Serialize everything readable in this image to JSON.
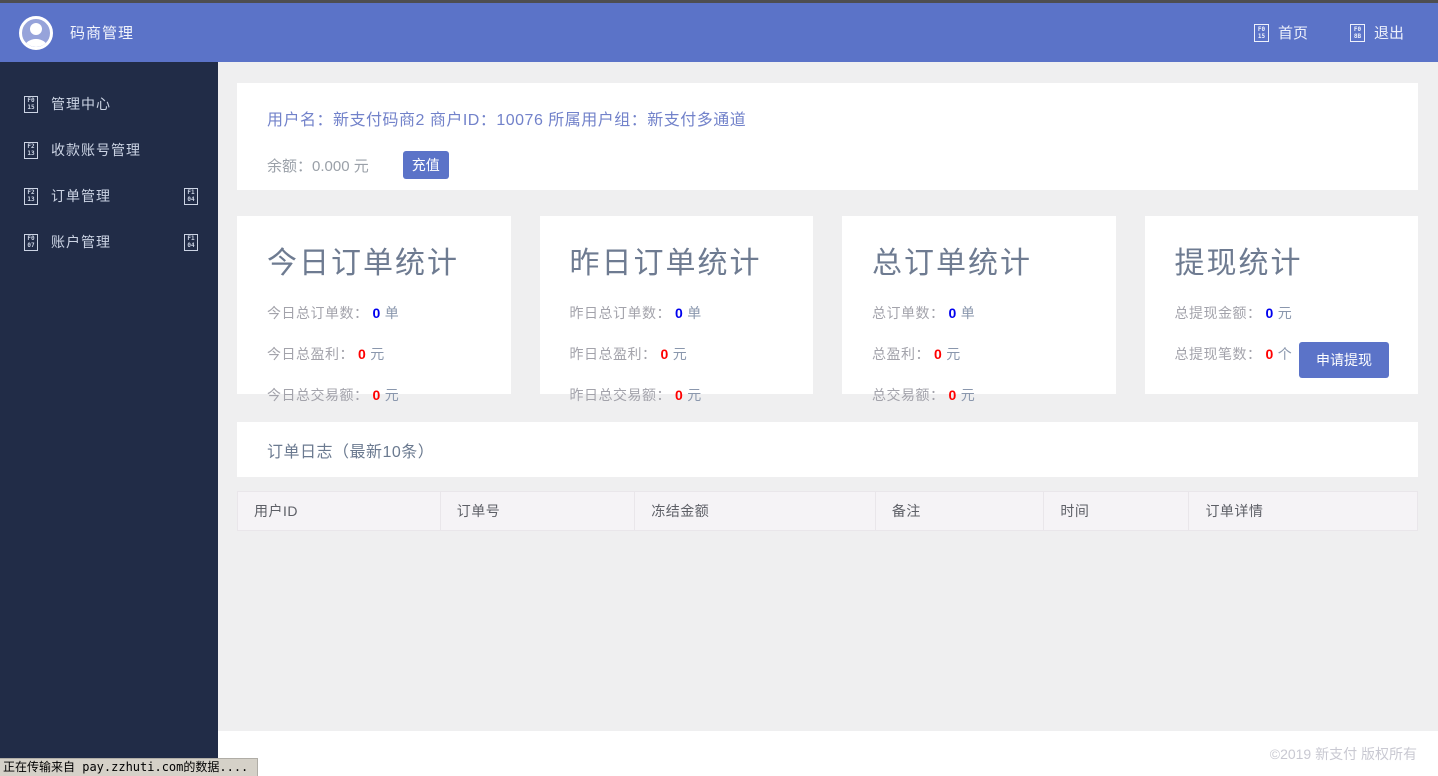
{
  "colors": {
    "header_bg": "#5b73c8",
    "sidebar_bg": "#212c47",
    "main_bg": "#efeff0",
    "accent_blue": "#5b73c8",
    "value_blue": "#0000ee",
    "value_red": "#ff0000"
  },
  "header": {
    "brand": "码商管理",
    "nav": [
      {
        "name": "home",
        "label": "首页",
        "icon": "home-icon",
        "glyph_hex": "F015"
      },
      {
        "name": "logout",
        "label": "退出",
        "icon": "logout-icon",
        "glyph_hex": "F08B"
      }
    ]
  },
  "sidebar": {
    "items": [
      {
        "name": "admin-center",
        "label": "管理中心",
        "icon": "home-icon",
        "glyph_hex": "F015",
        "chevron_hex": ""
      },
      {
        "name": "payment-accounts",
        "label": "收款账号管理",
        "icon": "card-icon",
        "glyph_hex": "F213",
        "chevron_hex": ""
      },
      {
        "name": "order-management",
        "label": "订单管理",
        "icon": "list-icon",
        "glyph_hex": "F213",
        "chevron_hex": "F104"
      },
      {
        "name": "account-management",
        "label": "账户管理",
        "icon": "user-icon",
        "glyph_hex": "F007",
        "chevron_hex": "F104"
      }
    ]
  },
  "user_card": {
    "info_line": "用户名：新支付码商2 商户ID：10076 所属用户组：新支付多通道",
    "balance": "余额：0.000 元",
    "recharge_button": "充值"
  },
  "stat_cards": [
    {
      "title": "今日订单统计",
      "rows": [
        {
          "label": "今日总订单数：",
          "value": "0",
          "unit": "单",
          "color": "blue"
        },
        {
          "label": "今日总盈利：",
          "value": "0",
          "unit": "元",
          "color": "red"
        },
        {
          "label": "今日总交易额：",
          "value": "0",
          "unit": "元",
          "color": "red"
        }
      ]
    },
    {
      "title": "昨日订单统计",
      "rows": [
        {
          "label": "昨日总订单数：",
          "value": "0",
          "unit": "单",
          "color": "blue"
        },
        {
          "label": "昨日总盈利：",
          "value": "0",
          "unit": "元",
          "color": "red"
        },
        {
          "label": "昨日总交易额：",
          "value": "0",
          "unit": "元",
          "color": "red"
        }
      ]
    },
    {
      "title": "总订单统计",
      "rows": [
        {
          "label": "总订单数：",
          "value": "0",
          "unit": "单",
          "color": "blue"
        },
        {
          "label": "总盈利：",
          "value": "0",
          "unit": "元",
          "color": "red"
        },
        {
          "label": "总交易额：",
          "value": "0",
          "unit": "元",
          "color": "red"
        }
      ]
    },
    {
      "title": "提现统计",
      "rows": [
        {
          "label": "总提现金额：",
          "value": "0",
          "unit": "元",
          "color": "blue"
        },
        {
          "label": "总提现笔数：",
          "value": "0",
          "unit": "个",
          "color": "red"
        }
      ],
      "button": "申请提现"
    }
  ],
  "order_log": {
    "title": "订单日志（最新10条）",
    "columns": [
      "用户ID",
      "订单号",
      "冻结金额",
      "备注",
      "时间",
      "订单详情"
    ],
    "rows": []
  },
  "footer": {
    "copyright": "©2019 新支付 版权所有"
  },
  "status_bar": {
    "text": "正在传输来自 pay.zzhuti.com的数据...."
  }
}
